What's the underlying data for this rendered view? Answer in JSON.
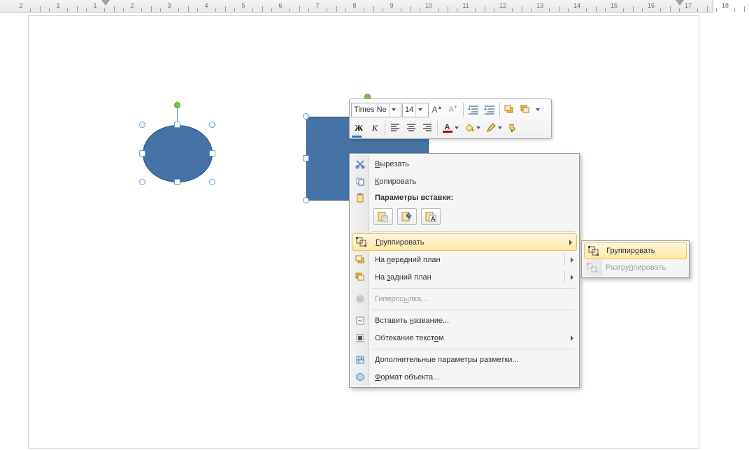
{
  "ruler": {
    "numbers": [
      "2",
      "1",
      "1",
      "2",
      "3",
      "4",
      "5",
      "6",
      "7",
      "8",
      "9",
      "10",
      "11",
      "12",
      "13",
      "14",
      "15",
      "16",
      "17",
      "18"
    ]
  },
  "shapes": {
    "circle_selected": true,
    "rect_selected": true
  },
  "mini_toolbar": {
    "font_name": "Times Ne",
    "font_size": "14"
  },
  "context_menu": {
    "cut": "Вырезать",
    "copy": "Копировать",
    "paste_params_header": "Параметры вставки:",
    "group": "Группировать",
    "bring_front": "На передний план",
    "send_back": "На задний план",
    "hyperlink": "Гиперссылка...",
    "insert_caption": "Вставить название...",
    "text_wrap": "Обтекание текстом",
    "more_layout": "Дополнительные параметры разметки...",
    "format_object": "Формат объекта..."
  },
  "submenu": {
    "group": "Группировать",
    "ungroup": "Разгруппировать"
  }
}
